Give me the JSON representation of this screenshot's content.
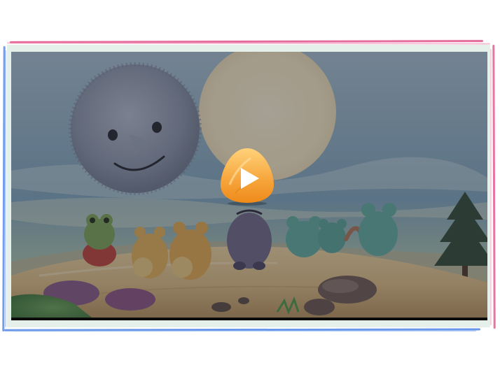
{
  "player": {
    "play_icon": "play-icon",
    "state": "paused"
  },
  "frame": {
    "top_color": "#e0528a",
    "left_color": "#4f86e8",
    "mat_color": "#e5f0ea"
  },
  "play_button": {
    "gradient_top": "#ffd27a",
    "gradient_bottom": "#ee8a1a",
    "triangle_color": "#ffffff"
  }
}
